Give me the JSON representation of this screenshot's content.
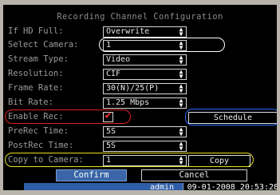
{
  "dialog": {
    "title": "Recording Channel Configuration"
  },
  "fields": {
    "if_hd_full": {
      "label": "If HD Full:",
      "value": "Overwrite"
    },
    "select_camera": {
      "label": "Select Camera:",
      "value": "1"
    },
    "stream_type": {
      "label": "Stream Type:",
      "value": "Video"
    },
    "resolution": {
      "label": "Resolution:",
      "value": "CIF"
    },
    "frame_rate": {
      "label": "Frame Rate:",
      "value": "30(N)/25(P)"
    },
    "bit_rate": {
      "label": "Bit Rate:",
      "value": "1.25 Mbps"
    },
    "enable_rec": {
      "label": "Enable Rec:",
      "checked": true
    },
    "prerec_time": {
      "label": "PreRec Time:",
      "value": "5S"
    },
    "postrec_time": {
      "label": "PostRec Time:",
      "value": "5S"
    },
    "copy_to_camera": {
      "label": "Copy to Camera:",
      "value": "1"
    }
  },
  "buttons": {
    "schedule": "Schedule",
    "copy": "Copy",
    "confirm": "Confirm",
    "cancel": "Cancel"
  },
  "status": {
    "user": "admin",
    "datetime": "09-01-2008 20:53:28"
  },
  "annotation_colors": {
    "select_camera": "#ffffff",
    "enable_rec": "#e02020",
    "schedule": "#2a6cff",
    "copy_row": "#e8e020"
  }
}
